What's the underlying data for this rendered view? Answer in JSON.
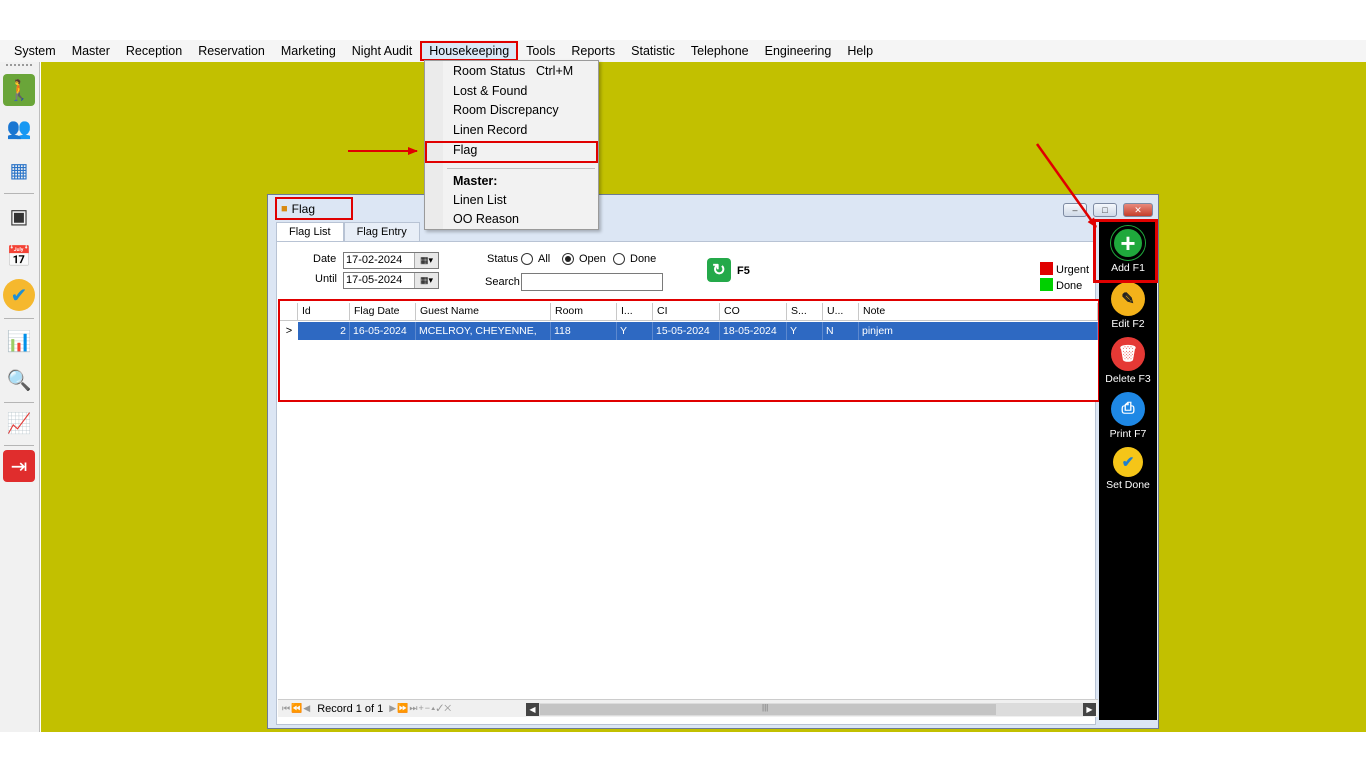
{
  "menubar": {
    "items": [
      "System",
      "Master",
      "Reception",
      "Reservation",
      "Marketing",
      "Night Audit",
      "Housekeeping",
      "Tools",
      "Reports",
      "Statistic",
      "Telephone",
      "Engineering",
      "Help"
    ],
    "highlighted": "Housekeeping"
  },
  "dropdown": {
    "room_status": "Room Status",
    "room_status_shortcut": "Ctrl+M",
    "lost_found": "Lost & Found",
    "room_discrepancy": "Room Discrepancy",
    "linen_record": "Linen Record",
    "flag": "Flag",
    "master_header": "Master:",
    "linen_list": "Linen List",
    "oo_reason": "OO Reason"
  },
  "window": {
    "title": "Flag",
    "tabs": [
      "Flag List",
      "Flag Entry"
    ],
    "active_tab": "Flag List"
  },
  "filters": {
    "date_label": "Date",
    "date_value": "17-02-2024",
    "until_label": "Until",
    "until_value": "17-05-2024",
    "status_label": "Status",
    "status_options": [
      "All",
      "Open",
      "Done"
    ],
    "status_selected": "Open",
    "search_label": "Search",
    "search_value": "",
    "refresh_label": "F5"
  },
  "legend": {
    "urgent_label": "Urgent",
    "urgent_color": "#e00000",
    "done_label": "Done",
    "done_color": "#00d000"
  },
  "grid": {
    "columns": [
      "Id",
      "Flag Date",
      "Guest Name",
      "Room",
      "I...",
      "CI",
      "CO",
      "S...",
      "U...",
      "Note"
    ],
    "rows": [
      [
        "2",
        "16-05-2024",
        "MCELROY, CHEYENNE,",
        "118",
        "Y",
        "15-05-2024",
        "18-05-2024",
        "Y",
        "N",
        "pinjem"
      ]
    ],
    "row_indicator": ">",
    "selected_row_color": "#2e69c2"
  },
  "navigator": {
    "record_text": "Record 1 of 1",
    "scroll_grip": "|||"
  },
  "actions": {
    "add": "Add F1",
    "edit": "Edit F2",
    "delete": "Delete F3",
    "print": "Print F7",
    "set_done": "Set Done"
  },
  "left_toolbar": {
    "icons": [
      "walk-in-icon",
      "guests-icon",
      "floor-plan-icon",
      "room-rack-icon",
      "calendar-icon",
      "housekeeping-icon",
      "night-audit-icon",
      "search-report-icon",
      "statistic-chart-icon",
      "logout-icon"
    ]
  },
  "colors": {
    "desktop": "#c2c000",
    "annotation": "#e00000",
    "action_panel": "#000000",
    "add_icon": "#1fa83c",
    "edit_icon": "#f3b21a",
    "delete_icon": "#e53935",
    "print_icon": "#1e88e5",
    "setdone_icon": "#f5c518"
  }
}
